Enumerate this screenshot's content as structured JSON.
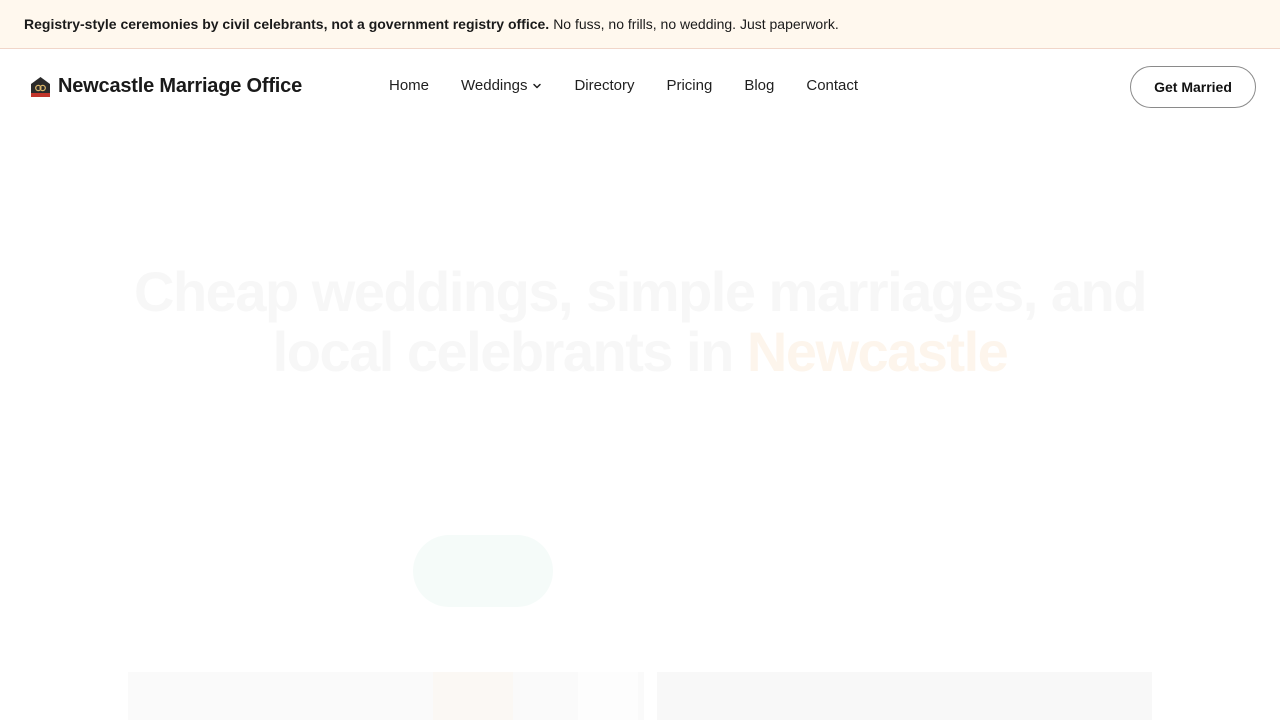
{
  "announcement": {
    "bold": "Registry-style ceremonies by civil celebrants, not a government registry office.",
    "text": "No fuss, no frills, no wedding. Just paperwork."
  },
  "brand": {
    "name": "Newcastle Marriage Office",
    "icon": "house-rings-icon"
  },
  "nav": {
    "items": [
      {
        "label": "Home"
      },
      {
        "label": "Weddings",
        "has_dropdown": true
      },
      {
        "label": "Directory"
      },
      {
        "label": "Pricing"
      },
      {
        "label": "Blog"
      },
      {
        "label": "Contact"
      }
    ]
  },
  "header": {
    "cta_label": "Get Married"
  },
  "hero": {
    "headline_main": "Cheap weddings, simple marriages, and local celebrants in",
    "headline_highlight": "Newcastle"
  },
  "colors": {
    "announcement_bg": "#fff8ee",
    "announcement_border": "#f1d6c9",
    "text": "#1a1a1a",
    "cta_border": "#8a8a8a"
  }
}
